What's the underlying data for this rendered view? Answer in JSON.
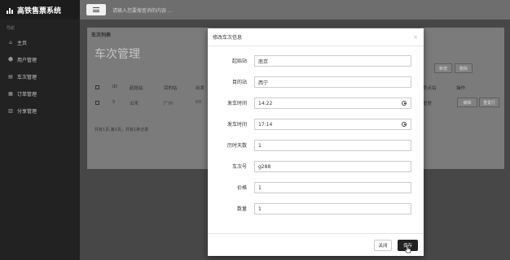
{
  "app": {
    "title": "高铁售票系统"
  },
  "sidebar": {
    "section_label": "导航",
    "items": [
      {
        "label": "主页",
        "icon": "home-icon"
      },
      {
        "label": "用户管理",
        "icon": "users-icon"
      },
      {
        "label": "车次管理",
        "icon": "train-icon"
      },
      {
        "label": "订单管理",
        "icon": "order-icon"
      },
      {
        "label": "分享管理",
        "icon": "share-icon"
      }
    ]
  },
  "topbar": {
    "search_placeholder": "请输入您要搜查询的内容 ..."
  },
  "background_page": {
    "breadcrumb": "车次列表",
    "title": "车次管理",
    "add_button": "新增",
    "delete_button": "删除",
    "table": {
      "headers": [
        "ID",
        "起始站",
        "目的站",
        "出发",
        "终点站",
        "操作"
      ],
      "row": [
        "5",
        "出来",
        "广州",
        "00",
        "重整"
      ],
      "row_actions": [
        "编辑",
        "重置行"
      ]
    },
    "pager_text": "共有1页,第1页，共有1条记录"
  },
  "modal": {
    "title": "修改车次信息",
    "close_icon": "close-icon",
    "fields": [
      {
        "label": "起始站",
        "value": "南京",
        "type": "text"
      },
      {
        "label": "目的站",
        "value": "西宁",
        "type": "text"
      },
      {
        "label": "发车时间",
        "value": "14:22",
        "type": "time"
      },
      {
        "label": "发车时间",
        "value": "17:14",
        "type": "time"
      },
      {
        "label": "历时天数",
        "value": "1",
        "type": "text"
      },
      {
        "label": "车次号",
        "value": "g288",
        "type": "text"
      },
      {
        "label": "价格",
        "value": "1",
        "type": "text"
      },
      {
        "label": "数量",
        "value": "1",
        "type": "text"
      }
    ],
    "close_button": "关闭",
    "save_button": "保存"
  }
}
